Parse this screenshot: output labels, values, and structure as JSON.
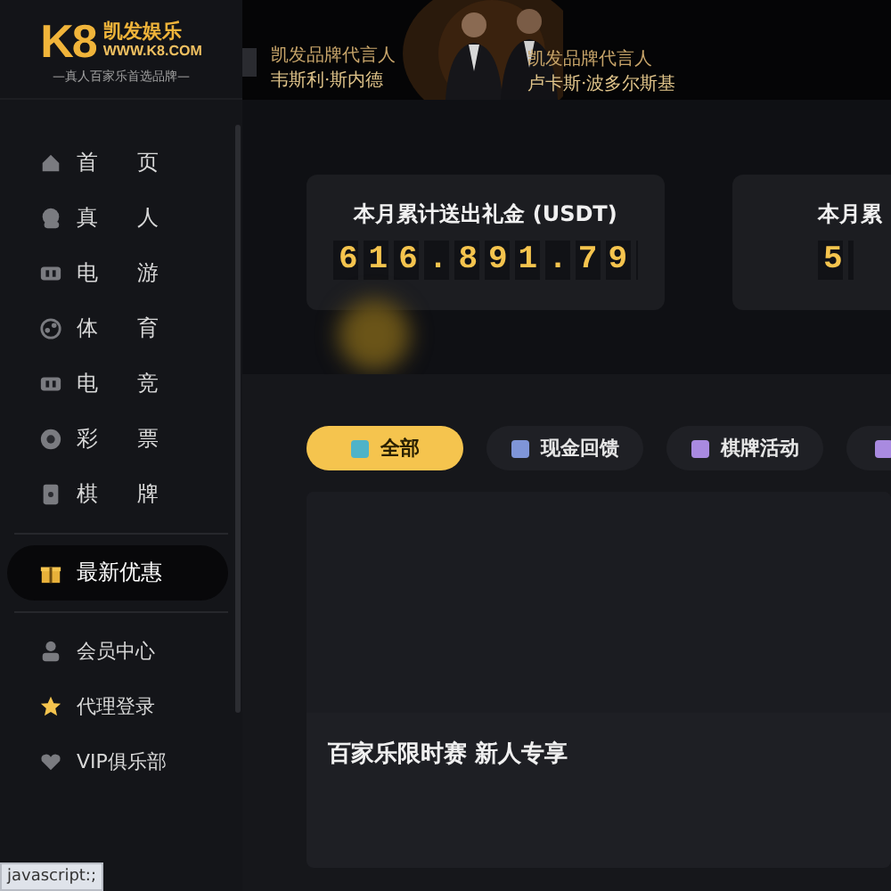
{
  "logo": {
    "brand": "K8",
    "name": "凯发娱乐",
    "url": "WWW.K8.COM",
    "slogan": "—真人百家乐首选品牌—"
  },
  "banner": {
    "captions": [
      {
        "role": "凯发品牌代言人",
        "name": "韦斯利·斯内德"
      },
      {
        "role": "凯发品牌代言人",
        "name": "卢卡斯·波多尔斯基"
      }
    ]
  },
  "sidebar": {
    "sections": [
      [
        {
          "label": "首页",
          "kind": "home",
          "selected": false
        },
        {
          "label": "真人",
          "kind": "live",
          "selected": false
        },
        {
          "label": "电游",
          "kind": "gamepad",
          "selected": false
        },
        {
          "label": "体育",
          "kind": "ball",
          "selected": false
        },
        {
          "label": "电竞",
          "kind": "gamepad",
          "selected": false
        },
        {
          "label": "彩票",
          "kind": "lottery",
          "selected": false
        },
        {
          "label": "棋牌",
          "kind": "card",
          "selected": false
        }
      ],
      [
        {
          "label": "最新优惠",
          "kind": "gift",
          "selected": true
        }
      ],
      [
        {
          "label": "会员中心",
          "kind": "user",
          "selected": false
        },
        {
          "label": "代理登录",
          "kind": "star",
          "selected": false
        },
        {
          "label": "VIP俱乐部",
          "kind": "heart",
          "selected": false
        }
      ]
    ]
  },
  "stats": [
    {
      "title": "本月累计送出礼金 (USDT)",
      "value": "616.891.79"
    },
    {
      "title": "本月累",
      "value": "5"
    }
  ],
  "tabs": [
    {
      "label": "全部",
      "color": "#4fb3c8",
      "selected": true
    },
    {
      "label": "现金回馈",
      "color": "#7f95d8",
      "selected": false
    },
    {
      "label": "棋牌活动",
      "color": "#a98ae0",
      "selected": false
    },
    {
      "color": "#a98ae0",
      "selected": false
    }
  ],
  "promo_card": {
    "title": "百家乐限时赛 新人专享"
  },
  "status_bar": "javascript:;"
}
